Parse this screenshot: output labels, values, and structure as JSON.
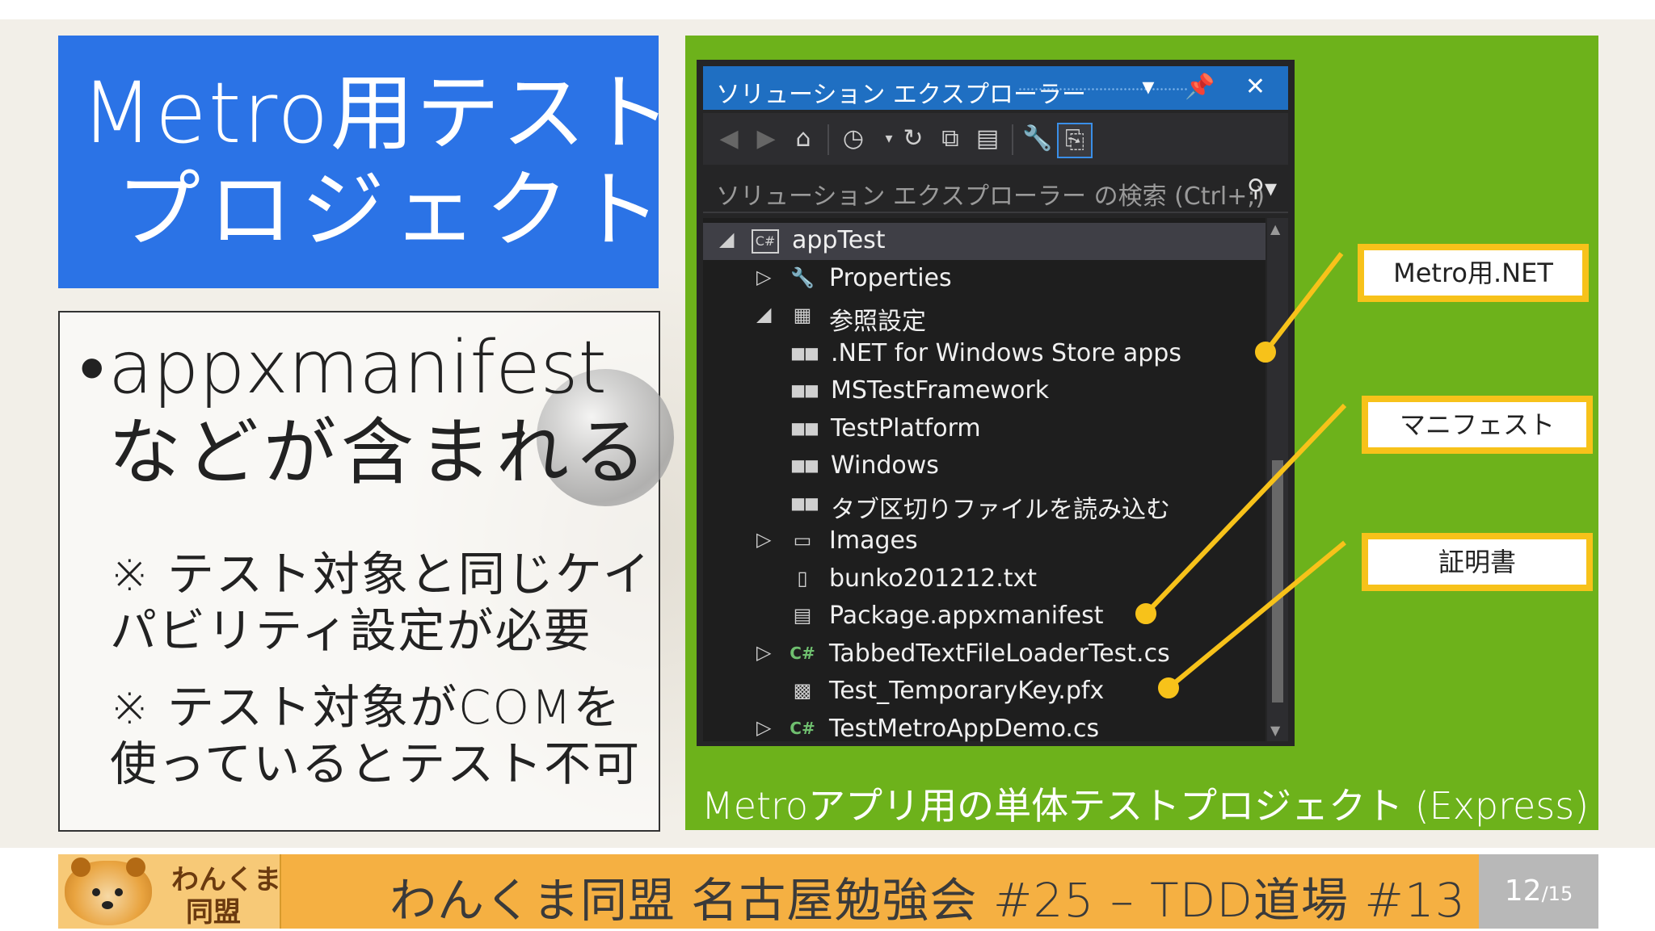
{
  "slide": {
    "title_line1": "Metro用テスト",
    "title_line2": "プロジェクト",
    "bullet_line1": "appxmanifest",
    "bullet_line2": "などが含まれる",
    "note1_line1": "※ テスト対象と同じケイ",
    "note1_line2": "パビリティ設定が必要",
    "note2_line1": "※ テスト対象がCOMを",
    "note2_line2": "使っているとテスト不可"
  },
  "panel": {
    "caption": "Metroアプリ用の単体テストプロジェクト (Express)"
  },
  "solution_explorer": {
    "title": "ソリューション エクスプローラー",
    "title_controls": "▾ 📌 ✕",
    "search_placeholder": "ソリューション エクスプローラー の検索 (Ctrl+;)",
    "tree": [
      {
        "label": "appTest",
        "icon": "csharp-project-icon",
        "expander": "◢"
      },
      {
        "label": "Properties",
        "icon": "wrench-icon",
        "expander": "▷"
      },
      {
        "label": "参照設定",
        "icon": "references-folder-icon",
        "expander": "◢"
      },
      {
        "label": ".NET for Windows Store apps",
        "icon": "reference-icon",
        "expander": ""
      },
      {
        "label": "MSTestFramework",
        "icon": "reference-icon",
        "expander": ""
      },
      {
        "label": "TestPlatform",
        "icon": "reference-icon",
        "expander": ""
      },
      {
        "label": "Windows",
        "icon": "reference-icon",
        "expander": ""
      },
      {
        "label": "タブ区切りファイルを読み込む",
        "icon": "reference-icon",
        "expander": ""
      },
      {
        "label": "Images",
        "icon": "folder-icon",
        "expander": "▷"
      },
      {
        "label": "bunko201212.txt",
        "icon": "text-file-icon",
        "expander": ""
      },
      {
        "label": "Package.appxmanifest",
        "icon": "manifest-file-icon",
        "expander": ""
      },
      {
        "label": "TabbedTextFileLoaderTest.cs",
        "icon": "csharp-file-icon",
        "expander": "▷"
      },
      {
        "label": "Test_TemporaryKey.pfx",
        "icon": "certificate-file-icon",
        "expander": ""
      },
      {
        "label": "TestMetroAppDemo.cs",
        "icon": "csharp-file-icon",
        "expander": "▷"
      }
    ]
  },
  "callouts": {
    "metro_net": "Metro用.NET",
    "manifest": "マニフェスト",
    "certificate": "証明書",
    "color": "#f7c21a"
  },
  "footer": {
    "title": "わんくま同盟 名古屋勉強会 #25 – TDD道場 #13",
    "logo_line1": "わんくま",
    "logo_line2": "同盟",
    "page_current": "12",
    "page_total": "/15"
  },
  "colors": {
    "title_blue": "#2b73e6",
    "panel_green": "#6db21b",
    "footer_orange": "#f5b042",
    "vs_titlebar": "#1f6fc2"
  }
}
